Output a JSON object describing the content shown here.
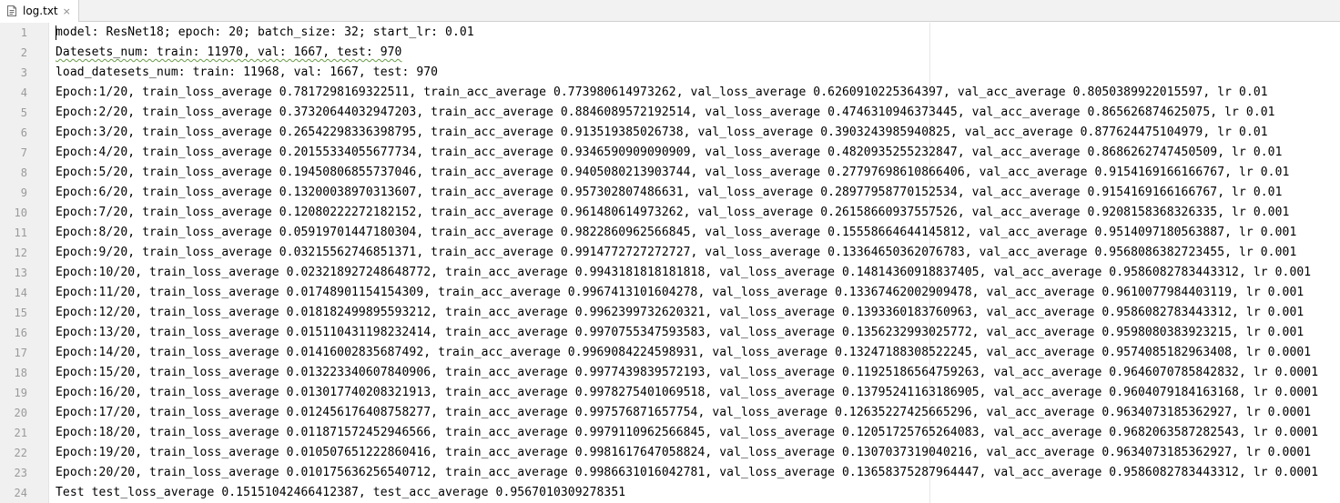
{
  "tab": {
    "file_name": "log.txt",
    "close_glyph": "×",
    "icon": "text-file-icon"
  },
  "editor": {
    "lines": [
      {
        "number": "1",
        "text": "model: ResNet18; epoch: 20; batch_size: 32; start_lr: 0.01"
      },
      {
        "number": "2",
        "text": "Datesets_num: train: 11970, val: 1667, test: 970"
      },
      {
        "number": "3",
        "text": "load_datesets_num: train: 11968, val: 1667, test: 970"
      },
      {
        "number": "4",
        "text": "Epoch:1/20, train_loss_average 0.7817298169322511, train_acc_average 0.773980614973262, val_loss_average 0.6260910225364397, val_acc_average 0.8050389922015597, lr 0.01"
      },
      {
        "number": "5",
        "text": "Epoch:2/20, train_loss_average 0.37320644032947203, train_acc_average 0.8846089572192514, val_loss_average 0.4746310946373445, val_acc_average 0.865626874625075, lr 0.01"
      },
      {
        "number": "6",
        "text": "Epoch:3/20, train_loss_average 0.26542298336398795, train_acc_average 0.913519385026738, val_loss_average 0.3903243985940825, val_acc_average 0.877624475104979, lr 0.01"
      },
      {
        "number": "7",
        "text": "Epoch:4/20, train_loss_average 0.20155334055677734, train_acc_average 0.9346590909090909, val_loss_average 0.4820935255232847, val_acc_average 0.8686262747450509, lr 0.01"
      },
      {
        "number": "8",
        "text": "Epoch:5/20, train_loss_average 0.19450806855737046, train_acc_average 0.9405080213903744, val_loss_average 0.27797698610866406, val_acc_average 0.9154169166166767, lr 0.01"
      },
      {
        "number": "9",
        "text": "Epoch:6/20, train_loss_average 0.13200038970313607, train_acc_average 0.957302807486631, val_loss_average 0.28977958770152534, val_acc_average 0.9154169166166767, lr 0.01"
      },
      {
        "number": "10",
        "text": "Epoch:7/20, train_loss_average 0.12080222272182152, train_acc_average 0.961480614973262, val_loss_average 0.26158660937557526, val_acc_average 0.9208158368326335, lr 0.001"
      },
      {
        "number": "11",
        "text": "Epoch:8/20, train_loss_average 0.05919701447180304, train_acc_average 0.9822860962566845, val_loss_average 0.15558664644145812, val_acc_average 0.9514097180563887, lr 0.001"
      },
      {
        "number": "12",
        "text": "Epoch:9/20, train_loss_average 0.03215562746851371, train_acc_average 0.9914772727272727, val_loss_average 0.13364650362076783, val_acc_average 0.9568086382723455, lr 0.001"
      },
      {
        "number": "13",
        "text": "Epoch:10/20, train_loss_average 0.023218927248648772, train_acc_average 0.9943181818181818, val_loss_average 0.14814360918837405, val_acc_average 0.9586082783443312, lr 0.001"
      },
      {
        "number": "14",
        "text": "Epoch:11/20, train_loss_average 0.01748901154154309, train_acc_average 0.9967413101604278, val_loss_average 0.13367462002909478, val_acc_average 0.9610077984403119, lr 0.001"
      },
      {
        "number": "15",
        "text": "Epoch:12/20, train_loss_average 0.018182499895593212, train_acc_average 0.9962399732620321, val_loss_average 0.1393360183760963, val_acc_average 0.9586082783443312, lr 0.001"
      },
      {
        "number": "16",
        "text": "Epoch:13/20, train_loss_average 0.015110431198232414, train_acc_average 0.9970755347593583, val_loss_average 0.1356232993025772, val_acc_average 0.9598080383923215, lr 0.001"
      },
      {
        "number": "17",
        "text": "Epoch:14/20, train_loss_average 0.01416002835687492, train_acc_average 0.9969084224598931, val_loss_average 0.13247188308522245, val_acc_average 0.9574085182963408, lr 0.0001"
      },
      {
        "number": "18",
        "text": "Epoch:15/20, train_loss_average 0.013223340607840906, train_acc_average 0.9977439839572193, val_loss_average 0.11925186564759263, val_acc_average 0.9646070785842832, lr 0.0001"
      },
      {
        "number": "19",
        "text": "Epoch:16/20, train_loss_average 0.013017740208321913, train_acc_average 0.9978275401069518, val_loss_average 0.13795241163186905, val_acc_average 0.9604079184163168, lr 0.0001"
      },
      {
        "number": "20",
        "text": "Epoch:17/20, train_loss_average 0.012456176408758277, train_acc_average 0.997576871657754, val_loss_average 0.12635227425665296, val_acc_average 0.9634073185362927, lr 0.0001"
      },
      {
        "number": "21",
        "text": "Epoch:18/20, train_loss_average 0.011871572452946566, train_acc_average 0.9979110962566845, val_loss_average 0.12051725765264083, val_acc_average 0.9682063587282543, lr 0.0001"
      },
      {
        "number": "22",
        "text": "Epoch:19/20, train_loss_average 0.010507651222860416, train_acc_average 0.9981617647058824, val_loss_average 0.1307037319040216, val_acc_average 0.9634073185362927, lr 0.0001"
      },
      {
        "number": "23",
        "text": "Epoch:20/20, train_loss_average 0.010175636256540712, train_acc_average 0.9986631016042781, val_loss_average 0.13658375287964447, val_acc_average 0.9586082783443312, lr 0.0001"
      },
      {
        "number": "24",
        "text": "Test test_loss_average 0.15151042466412387, test_acc_average 0.9567010309278351"
      }
    ]
  }
}
